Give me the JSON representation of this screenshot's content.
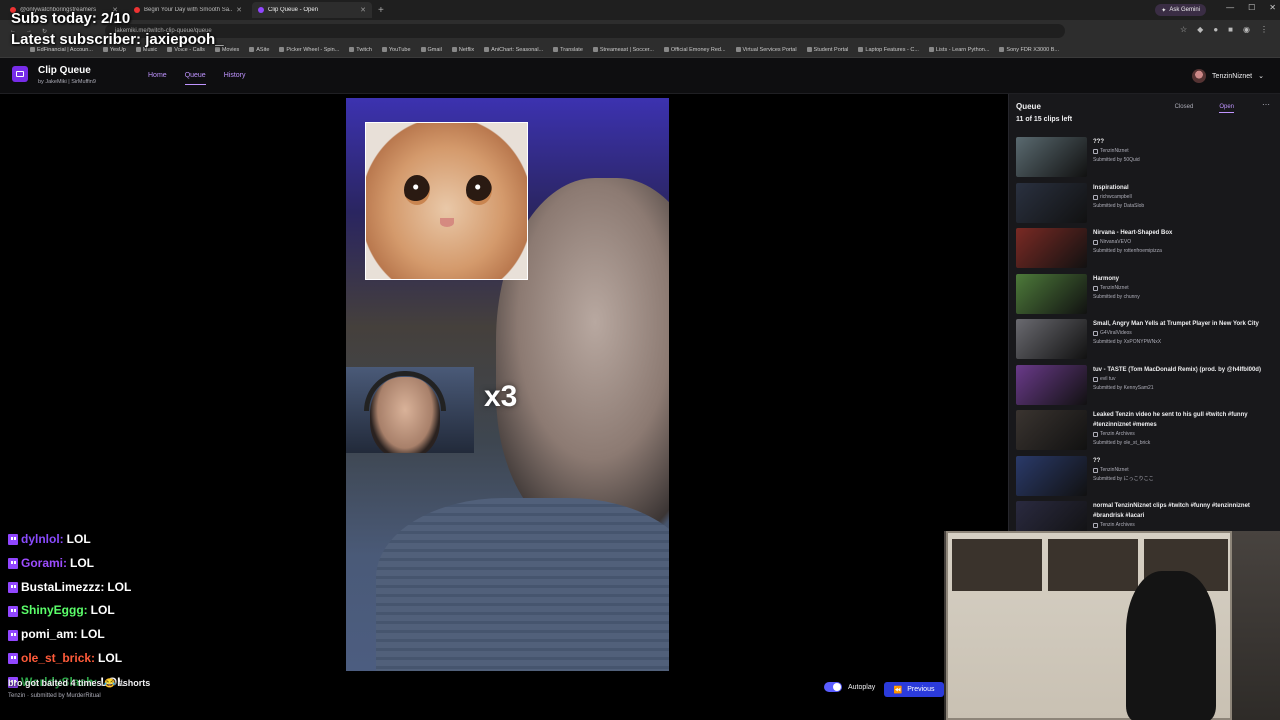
{
  "browser": {
    "tabs": [
      {
        "label": "@onlywatchboringstreamers",
        "active": false
      },
      {
        "label": "Begin Your Day with Smooth Sa...",
        "active": false
      },
      {
        "label": "Clip Queue - Open",
        "active": true
      }
    ],
    "url": "jakemiki.me/twitch-clip-queue/queue",
    "gemini_label": "Ask Gemini",
    "bookmarks": [
      "EdFinancial | Accoun...",
      "YesUp",
      "Music",
      "Voice - Calls",
      "Movies",
      "ASite",
      "Picker Wheel - Spin...",
      "Twitch",
      "YouTube",
      "Gmail",
      "Netflix",
      "AniChart: Seasonal...",
      "Translate",
      "Streameast | Soccer...",
      "Official Emoney Red...",
      "Virtual Services Portal",
      "Student Portal",
      "Laptop Features - C...",
      "Lists - Learn Python...",
      "Sony FDR X3000 B..."
    ]
  },
  "overlay": {
    "subs_today": "Subs today: 2/10",
    "latest_subscriber": "Latest subscriber: jaxiepooh_"
  },
  "app": {
    "title": "Clip Queue",
    "byline": "by JakeMiki | SirMuffin9",
    "nav": [
      "Home",
      "Queue",
      "History"
    ],
    "active_nav": "Queue",
    "username": "TenzinNiznet"
  },
  "video": {
    "multiplier_text": "x3"
  },
  "chat": [
    {
      "user": "dylnlol:",
      "message": "LOL",
      "color": "#8a4bff"
    },
    {
      "user": "Gorami:",
      "message": "LOL",
      "color": "#9d4dff"
    },
    {
      "user": "BustaLimezzz:",
      "message": "LOL",
      "color": "#ffffff"
    },
    {
      "user": "ShinyEggg:",
      "message": "LOL",
      "color": "#5bff6a"
    },
    {
      "user": "pomi_am:",
      "message": "LOL",
      "color": "#ffffff"
    },
    {
      "user": "ole_st_brick:",
      "message": "LOL",
      "color": "#ff5b3a"
    },
    {
      "user": "WorldySlash:",
      "message": "LOL",
      "color": "#2ea84a"
    }
  ],
  "current_clip": {
    "title": "bro got baited 4 times 😂 #shorts",
    "info": "Tenzin · submitted by MurderRitual"
  },
  "controls": {
    "autoplay_label": "Autoplay",
    "autoplay_on": true,
    "previous_label": "Previous"
  },
  "queue": {
    "title": "Queue",
    "count": "11 of 15 clips left",
    "tabs": [
      "Closed",
      "Open"
    ],
    "active_tab": "Open",
    "items": [
      {
        "title": "???",
        "author": "TenzinNiznet",
        "submitted": "Submitted by 50Quid",
        "thumb": "#5a6a70"
      },
      {
        "title": "Inspirational",
        "author": "richwcampbell",
        "submitted": "Submitted by DataSlob",
        "thumb": "#2a3140"
      },
      {
        "title": "Nirvana - Heart-Shaped Box",
        "author": "NirvanaVEVO",
        "submitted": "Submitted by rottenfroemipizza",
        "thumb": "#7a2a24"
      },
      {
        "title": "Harmony",
        "author": "TenzinNiznet",
        "submitted": "Submitted by chunny",
        "thumb": "#4d7a3a"
      },
      {
        "title": "Small, Angry Man Yells at Trumpet Player in New York City",
        "author": "G4ViralVideos",
        "submitted": "Submitted by XxPONYPWNxX",
        "thumb": "#6a6a70"
      },
      {
        "title": "tuv - TASTE (Tom MacDonald Remix) (prod. by @h4lfbl00d)",
        "author": "evil tuv",
        "submitted": "Submitted by KennySam21",
        "thumb": "#6a3a8a"
      },
      {
        "title": "Leaked Tenzin video he sent to his gull #twitch #funny #tenzinniznet #memes",
        "author": "Tenzin Archives",
        "submitted": "Submitted by ole_st_brick",
        "thumb": "#3a3430"
      },
      {
        "title": "??",
        "author": "TenzinNiznet",
        "submitted": "Submitted by にっこりここ",
        "thumb": "#2a3a6a"
      },
      {
        "title": "normal TenzinNiznet clips #twitch #funny #tenzinniznet #brandrisk #lacari",
        "author": "Tenzin Archives",
        "submitted": "",
        "thumb": "#2a2a40"
      }
    ]
  }
}
